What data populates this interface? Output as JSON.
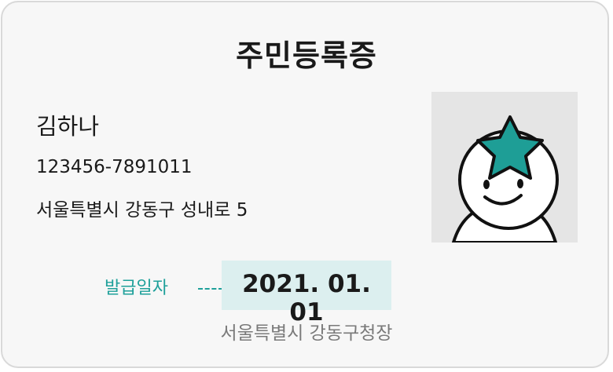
{
  "card": {
    "title": "주민등록증",
    "name": "김하나",
    "id_number": "123456-7891011",
    "address": "서울특별시 강동구 성내로 5",
    "issue_label": "발급일자",
    "issue_date": "2021. 01. 01",
    "issuer": "서울특별시 강동구청장",
    "photo_icon": "star-head-character-icon"
  },
  "colors": {
    "accent": "#1ea09a",
    "date_highlight": "#dcefef",
    "card_background": "#f7f7f7",
    "card_border": "#d9d9d9",
    "photo_background": "#e5e5e5",
    "star": "#1e9e96"
  }
}
